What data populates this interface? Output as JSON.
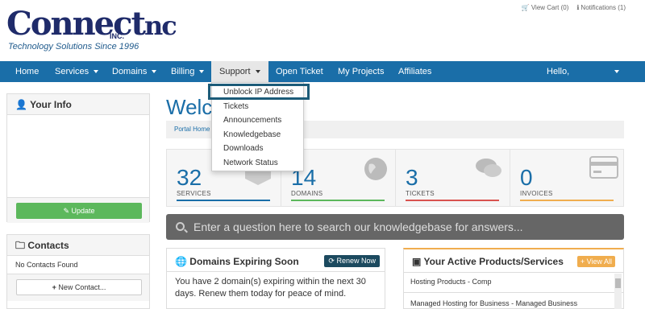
{
  "brand": {
    "logo_main": "Connect",
    "logo_nc": "nc",
    "logo_inc": "INC.",
    "tagline": "Technology Solutions Since 1996"
  },
  "top_links": {
    "cart": "View Cart (0)",
    "notifications": "Notifications (1)"
  },
  "nav": {
    "home": "Home",
    "services": "Services",
    "domains": "Domains",
    "billing": "Billing",
    "support": "Support",
    "open_ticket": "Open Ticket",
    "my_projects": "My Projects",
    "affiliates": "Affiliates",
    "user": "Hello,"
  },
  "support_menu": {
    "items": [
      "Unblock IP Address",
      "Tickets",
      "Announcements",
      "Knowledgebase",
      "Downloads",
      "Network Status"
    ]
  },
  "sidebar": {
    "your_info_title": "Your Info",
    "update_label": "Update",
    "contacts_title": "Contacts",
    "no_contacts": "No Contacts Found",
    "new_contact_label": "New Contact..."
  },
  "main": {
    "welcome": "Welc",
    "breadcrumb": "Portal Home"
  },
  "stats": [
    {
      "value": "32",
      "label": "SERVICES",
      "color": "#1a6ea8"
    },
    {
      "value": "14",
      "label": "DOMAINS",
      "color": "#5cb85c"
    },
    {
      "value": "3",
      "label": "TICKETS",
      "color": "#d9534f"
    },
    {
      "value": "0",
      "label": "INVOICES",
      "color": "#f0ad4e"
    }
  ],
  "search": {
    "placeholder": "Enter a question here to search our knowledgebase for answers..."
  },
  "domains_panel": {
    "title": "Domains Expiring Soon",
    "renew_label": "Renew Now",
    "message": "You have 2 domain(s) expiring within the next 30 days. Renew them today for peace of mind."
  },
  "products_panel": {
    "title": "Your Active Products/Services",
    "view_all_label": "View All",
    "items": [
      "Hosting Products - Comp",
      "Managed Hosting for Business - Managed Business"
    ]
  },
  "colors": {
    "navbar": "#1a6ea8",
    "accent": "#1a6ea8",
    "highlight": "#1c5b78"
  }
}
